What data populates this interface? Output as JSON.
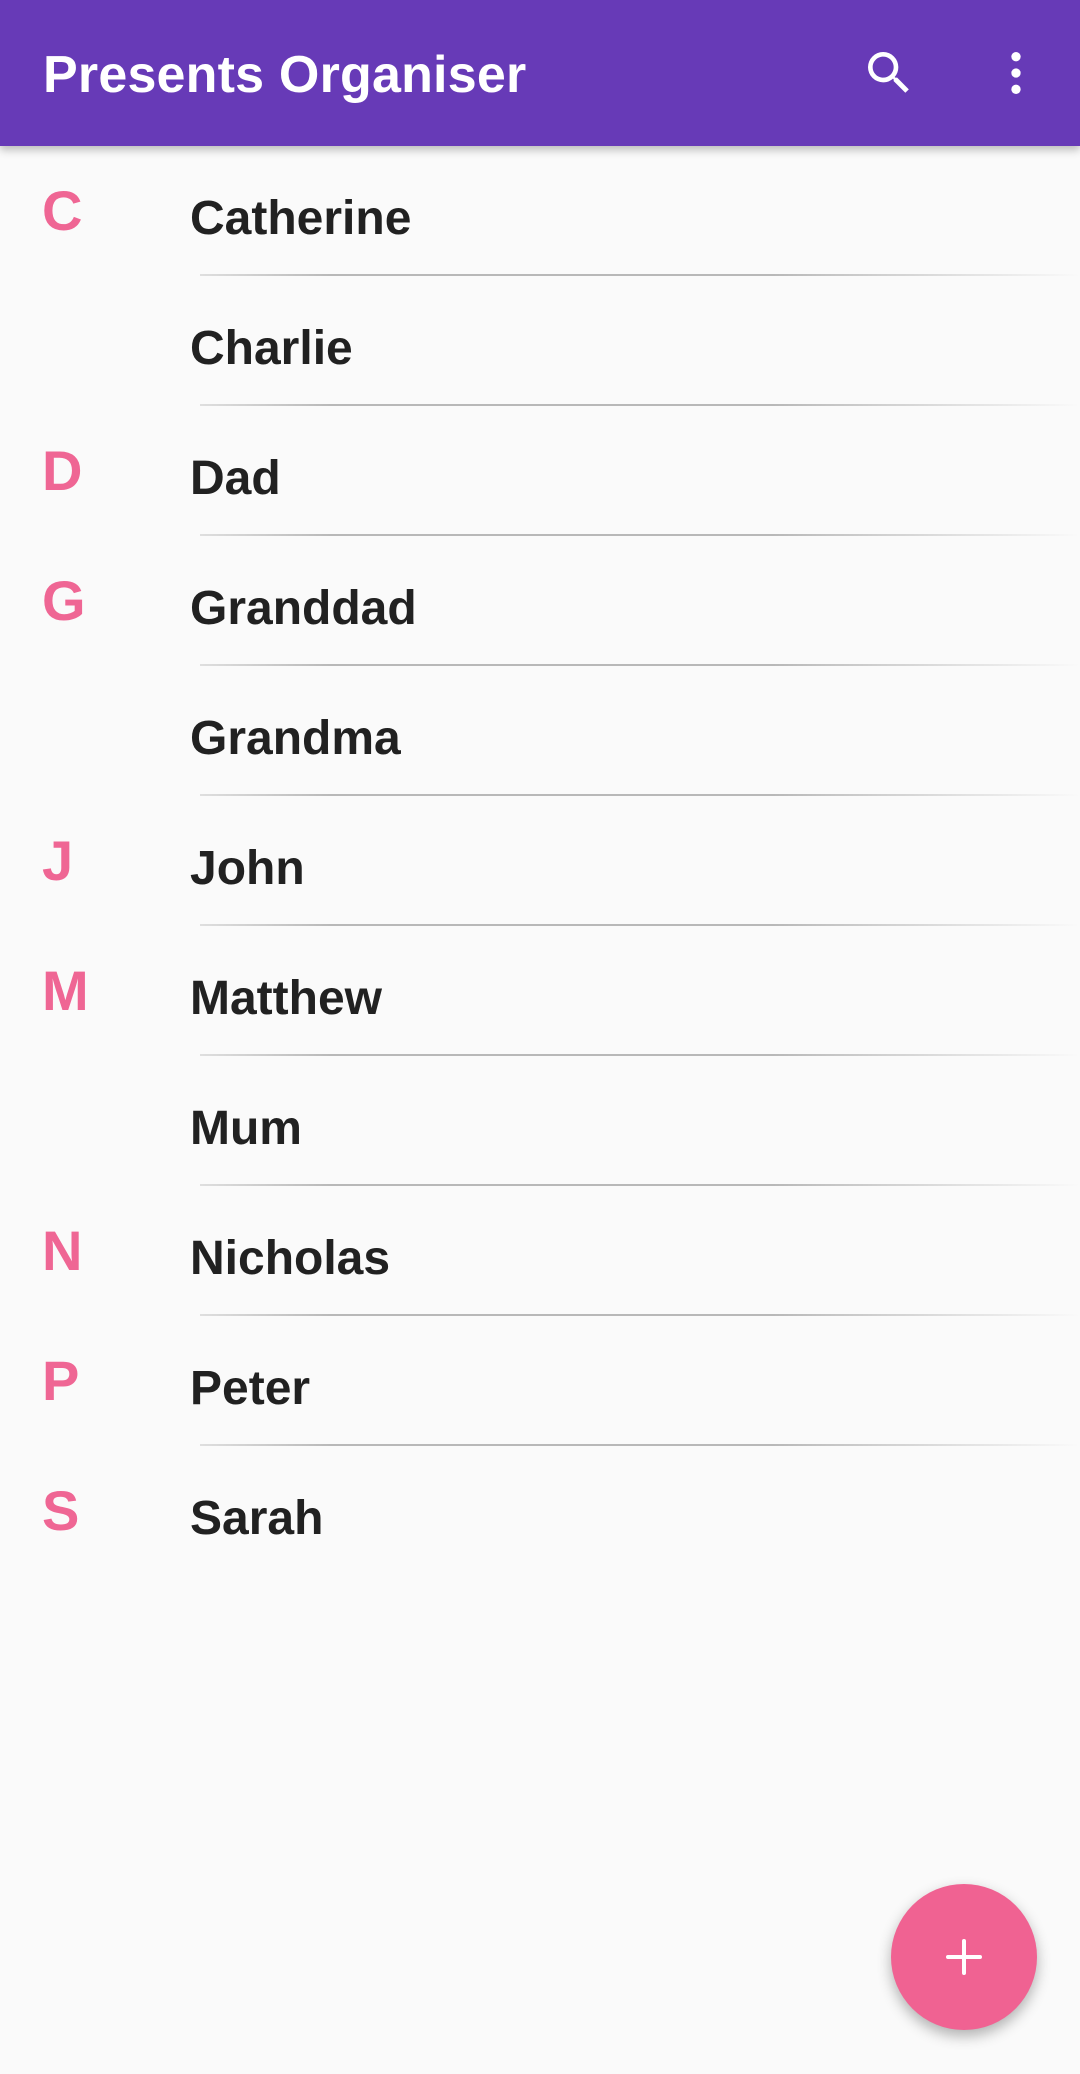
{
  "app": {
    "title": "Presents Organiser"
  },
  "toolbar": {
    "search_icon": "search-icon",
    "overflow_icon": "more-vert-icon"
  },
  "colors": {
    "app_bar": "#673ab7",
    "accent": "#f06292",
    "section_letter": "#ef6694",
    "name_text": "#212121",
    "background": "#fafafa"
  },
  "people": [
    {
      "letter": "C",
      "name": "Catherine"
    },
    {
      "letter": "",
      "name": "Charlie"
    },
    {
      "letter": "D",
      "name": "Dad"
    },
    {
      "letter": "G",
      "name": "Granddad"
    },
    {
      "letter": "",
      "name": "Grandma"
    },
    {
      "letter": "J",
      "name": "John"
    },
    {
      "letter": "M",
      "name": "Matthew"
    },
    {
      "letter": "",
      "name": "Mum"
    },
    {
      "letter": "N",
      "name": "Nicholas"
    },
    {
      "letter": "P",
      "name": "Peter"
    },
    {
      "letter": "S",
      "name": "Sarah"
    }
  ],
  "fab": {
    "icon": "add-icon"
  }
}
